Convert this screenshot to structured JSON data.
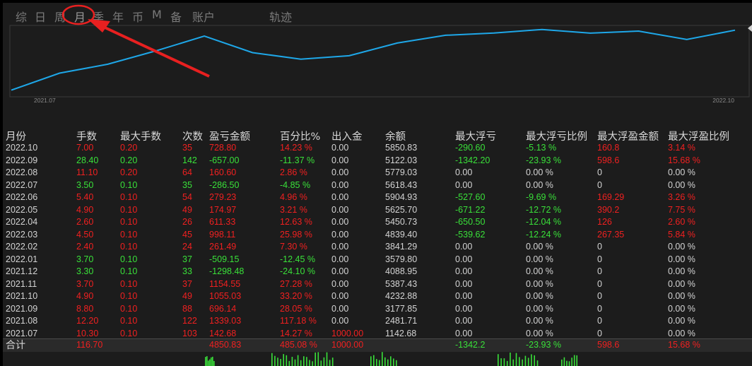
{
  "tabs": [
    {
      "label": "综"
    },
    {
      "label": "日"
    },
    {
      "label": "周"
    },
    {
      "label": "月",
      "selected": true
    },
    {
      "label": "季"
    },
    {
      "label": "年"
    },
    {
      "label": "币"
    },
    {
      "label": "M"
    },
    {
      "label": "备"
    },
    {
      "label": "账户"
    },
    {
      "label": "轨迹"
    }
  ],
  "colors": {
    "line": "#1ea7e8",
    "arrow": "#e82020",
    "red": "#f02020",
    "green": "#39e039",
    "panel": "#1c1c1c"
  },
  "chart_data": {
    "type": "line",
    "x_ticks": [
      "2021.07",
      "2022.10"
    ],
    "x": [
      "2021.07",
      "2021.08",
      "2021.09",
      "2021.10",
      "2021.11",
      "2021.12",
      "2022.01",
      "2022.02",
      "2022.03",
      "2022.04",
      "2022.05",
      "2022.06",
      "2022.07",
      "2022.08",
      "2022.09",
      "2022.10"
    ],
    "values": [
      1142.68,
      2481.71,
      3177.85,
      4232.88,
      5387.43,
      4088.95,
      3579.8,
      3841.29,
      4839.4,
      5450.73,
      5625.7,
      5904.93,
      5618.43,
      5779.03,
      5122.03,
      5850.83
    ],
    "grid": false
  },
  "table": {
    "headers": [
      "月份",
      "手数",
      "最大手数",
      "次数",
      "盈亏金额",
      "百分比%",
      "出入金",
      "余额",
      "最大浮亏",
      "最大浮亏比例",
      "最大浮盈金额",
      "最大浮盈比例"
    ],
    "rows": [
      {
        "month": "2022.10",
        "lots": "7.00",
        "max_lots": "0.20",
        "count": "35",
        "pnl": "728.80",
        "pct": "14.23 %",
        "io": "0.00",
        "balance": "5850.83",
        "max_float_loss": "-290.60",
        "max_float_loss_pct": "-5.13 %",
        "max_float_profit": "160.8",
        "max_float_profit_pct": "3.14 %",
        "tone": "red",
        "loss_tone": "green",
        "profit_tone": "red"
      },
      {
        "month": "2022.09",
        "lots": "28.40",
        "max_lots": "0.20",
        "count": "142",
        "pnl": "-657.00",
        "pct": "-11.37 %",
        "io": "0.00",
        "balance": "5122.03",
        "max_float_loss": "-1342.20",
        "max_float_loss_pct": "-23.93 %",
        "max_float_profit": "598.6",
        "max_float_profit_pct": "15.68 %",
        "tone": "green",
        "loss_tone": "green",
        "profit_tone": "red"
      },
      {
        "month": "2022.08",
        "lots": "11.10",
        "max_lots": "0.20",
        "count": "64",
        "pnl": "160.60",
        "pct": "2.86 %",
        "io": "0.00",
        "balance": "5779.03",
        "max_float_loss": "0.00",
        "max_float_loss_pct": "0.00 %",
        "max_float_profit": "0",
        "max_float_profit_pct": "0.00 %",
        "tone": "red",
        "loss_tone": "white",
        "profit_tone": "white"
      },
      {
        "month": "2022.07",
        "lots": "3.50",
        "max_lots": "0.10",
        "count": "35",
        "pnl": "-286.50",
        "pct": "-4.85 %",
        "io": "0.00",
        "balance": "5618.43",
        "max_float_loss": "0.00",
        "max_float_loss_pct": "0.00 %",
        "max_float_profit": "0",
        "max_float_profit_pct": "0.00 %",
        "tone": "green",
        "loss_tone": "white",
        "profit_tone": "white"
      },
      {
        "month": "2022.06",
        "lots": "5.40",
        "max_lots": "0.10",
        "count": "54",
        "pnl": "279.23",
        "pct": "4.96 %",
        "io": "0.00",
        "balance": "5904.93",
        "max_float_loss": "-527.60",
        "max_float_loss_pct": "-9.69 %",
        "max_float_profit": "169.29",
        "max_float_profit_pct": "3.26 %",
        "tone": "red",
        "loss_tone": "green",
        "profit_tone": "red"
      },
      {
        "month": "2022.05",
        "lots": "4.90",
        "max_lots": "0.10",
        "count": "49",
        "pnl": "174.97",
        "pct": "3.21 %",
        "io": "0.00",
        "balance": "5625.70",
        "max_float_loss": "-671.22",
        "max_float_loss_pct": "-12.72 %",
        "max_float_profit": "390.2",
        "max_float_profit_pct": "7.75 %",
        "tone": "red",
        "loss_tone": "green",
        "profit_tone": "red"
      },
      {
        "month": "2022.04",
        "lots": "2.60",
        "max_lots": "0.10",
        "count": "26",
        "pnl": "611.33",
        "pct": "12.63 %",
        "io": "0.00",
        "balance": "5450.73",
        "max_float_loss": "-650.50",
        "max_float_loss_pct": "-12.04 %",
        "max_float_profit": "126",
        "max_float_profit_pct": "2.60 %",
        "tone": "red",
        "loss_tone": "green",
        "profit_tone": "red"
      },
      {
        "month": "2022.03",
        "lots": "4.50",
        "max_lots": "0.10",
        "count": "45",
        "pnl": "998.11",
        "pct": "25.98 %",
        "io": "0.00",
        "balance": "4839.40",
        "max_float_loss": "-539.62",
        "max_float_loss_pct": "-12.24 %",
        "max_float_profit": "267.35",
        "max_float_profit_pct": "5.84 %",
        "tone": "red",
        "loss_tone": "green",
        "profit_tone": "red"
      },
      {
        "month": "2022.02",
        "lots": "2.40",
        "max_lots": "0.10",
        "count": "24",
        "pnl": "261.49",
        "pct": "7.30 %",
        "io": "0.00",
        "balance": "3841.29",
        "max_float_loss": "0.00",
        "max_float_loss_pct": "0.00 %",
        "max_float_profit": "0",
        "max_float_profit_pct": "0.00 %",
        "tone": "red",
        "loss_tone": "white",
        "profit_tone": "white"
      },
      {
        "month": "2022.01",
        "lots": "3.70",
        "max_lots": "0.10",
        "count": "37",
        "pnl": "-509.15",
        "pct": "-12.45 %",
        "io": "0.00",
        "balance": "3579.80",
        "max_float_loss": "0.00",
        "max_float_loss_pct": "0.00 %",
        "max_float_profit": "0",
        "max_float_profit_pct": "0.00 %",
        "tone": "green",
        "loss_tone": "white",
        "profit_tone": "white"
      },
      {
        "month": "2021.12",
        "lots": "3.30",
        "max_lots": "0.10",
        "count": "33",
        "pnl": "-1298.48",
        "pct": "-24.10 %",
        "io": "0.00",
        "balance": "4088.95",
        "max_float_loss": "0.00",
        "max_float_loss_pct": "0.00 %",
        "max_float_profit": "0",
        "max_float_profit_pct": "0.00 %",
        "tone": "green",
        "loss_tone": "white",
        "profit_tone": "white"
      },
      {
        "month": "2021.11",
        "lots": "3.70",
        "max_lots": "0.10",
        "count": "37",
        "pnl": "1154.55",
        "pct": "27.28 %",
        "io": "0.00",
        "balance": "5387.43",
        "max_float_loss": "0.00",
        "max_float_loss_pct": "0.00 %",
        "max_float_profit": "0",
        "max_float_profit_pct": "0.00 %",
        "tone": "red",
        "loss_tone": "white",
        "profit_tone": "white"
      },
      {
        "month": "2021.10",
        "lots": "4.90",
        "max_lots": "0.10",
        "count": "49",
        "pnl": "1055.03",
        "pct": "33.20 %",
        "io": "0.00",
        "balance": "4232.88",
        "max_float_loss": "0.00",
        "max_float_loss_pct": "0.00 %",
        "max_float_profit": "0",
        "max_float_profit_pct": "0.00 %",
        "tone": "red",
        "loss_tone": "white",
        "profit_tone": "white"
      },
      {
        "month": "2021.09",
        "lots": "8.80",
        "max_lots": "0.10",
        "count": "88",
        "pnl": "696.14",
        "pct": "28.05 %",
        "io": "0.00",
        "balance": "3177.85",
        "max_float_loss": "0.00",
        "max_float_loss_pct": "0.00 %",
        "max_float_profit": "0",
        "max_float_profit_pct": "0.00 %",
        "tone": "red",
        "loss_tone": "white",
        "profit_tone": "white"
      },
      {
        "month": "2021.08",
        "lots": "12.20",
        "max_lots": "0.10",
        "count": "122",
        "pnl": "1339.03",
        "pct": "117.18 %",
        "io": "0.00",
        "balance": "2481.71",
        "max_float_loss": "0.00",
        "max_float_loss_pct": "0.00 %",
        "max_float_profit": "0",
        "max_float_profit_pct": "0.00 %",
        "tone": "red",
        "loss_tone": "white",
        "profit_tone": "white"
      },
      {
        "month": "2021.07",
        "lots": "10.30",
        "max_lots": "0.10",
        "count": "103",
        "pnl": "142.68",
        "pct": "14.27 %",
        "io": "1000.00",
        "balance": "1142.68",
        "max_float_loss": "0.00",
        "max_float_loss_pct": "0.00 %",
        "max_float_profit": "0",
        "max_float_profit_pct": "0.00 %",
        "tone": "red",
        "loss_tone": "white",
        "profit_tone": "white",
        "io_tone": "red"
      }
    ],
    "total": {
      "label": "合计",
      "lots": "116.70",
      "pnl": "4850.83",
      "pct": "485.08 %",
      "io": "1000.00",
      "max_float_loss": "-1342.2",
      "max_float_loss_pct": "-23.93 %",
      "max_float_profit": "598.6",
      "max_float_profit_pct": "15.68 %"
    }
  }
}
